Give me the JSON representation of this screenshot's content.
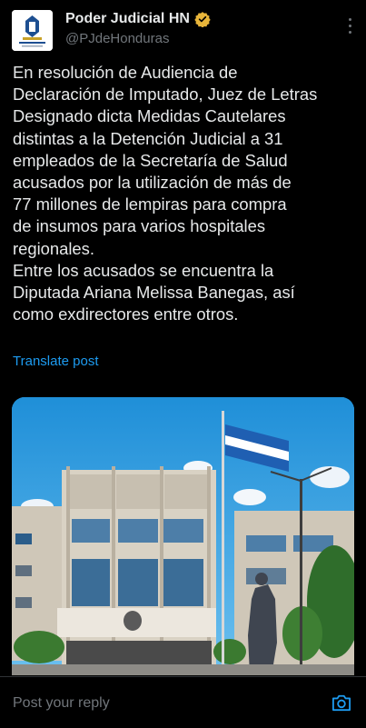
{
  "author": {
    "display_name": "Poder Judicial HN",
    "handle": "@PJdeHonduras",
    "avatar_caption": "PODER JUDICIAL"
  },
  "post": {
    "text": "En resolución de Audiencia de\nDeclaración de Imputado, Juez de Letras\nDesignado dicta Medidas Cautelares\ndistintas a la Detención Judicial a 31\nempleados de la Secretaría de Salud\nacusados por la utilización de más de\n77 millones de lempiras para compra\nde insumos para varios hospitales\nregionales.\nEntre los acusados se encuentra la\nDiputada Ariana Melissa Banegas, así\ncomo exdirectores entre otros.",
    "translate_label": "Translate post"
  },
  "reply": {
    "placeholder": "Post your reply"
  },
  "colors": {
    "background": "#000000",
    "text": "#e7e9ea",
    "muted": "#71767b",
    "accent": "#1d9bf0",
    "verified": "#e8b53a"
  },
  "icons": {
    "verified": "verified-badge-icon",
    "more": "more-vertical-icon",
    "camera": "camera-icon"
  }
}
